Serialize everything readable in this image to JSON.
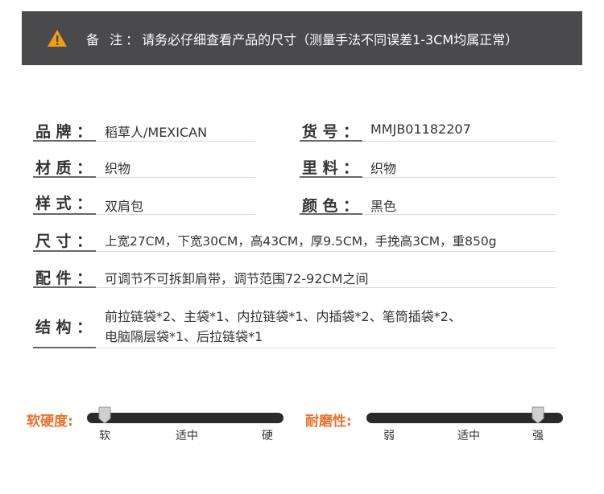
{
  "notice": {
    "label": "备 注：",
    "text": "请务必仔细查看产品的尺寸（测量手法不同误差1-3CM均属正常）",
    "icon": "warning-icon",
    "accent": "#f39c12"
  },
  "specs": {
    "brand": {
      "label": "品牌：",
      "value": "稻草人/MEXICAN"
    },
    "item_no": {
      "label": "货号：",
      "value": "MMJB01182207"
    },
    "material": {
      "label": "材质：",
      "value": "织物"
    },
    "lining": {
      "label": "里料：",
      "value": "织物"
    },
    "style": {
      "label": "样式：",
      "value": "双肩包"
    },
    "color": {
      "label": "颜色：",
      "value": "黑色"
    },
    "size": {
      "label": "尺寸：",
      "value": "上宽27CM，下宽30CM，高43CM，厚9.5CM，手挽高3CM，重850g"
    },
    "accessories": {
      "label": "配件：",
      "value": "可调节不可拆卸肩带，调节范围72-92CM之间"
    },
    "structure": {
      "label": "结构：",
      "line1": "前拉链袋*2、主袋*1、内拉链袋*1、内插袋*2、笔筒插袋*2、",
      "line2": "电脑隔层袋*1、后拉链袋*1"
    }
  },
  "sliders": {
    "softness": {
      "label": "软硬度:",
      "ticks": [
        "软",
        "适中",
        "硬"
      ],
      "level": 0.0
    },
    "durability": {
      "label": "耐磨性:",
      "ticks": [
        "弱",
        "适中",
        "强"
      ],
      "level": 1.0
    }
  },
  "colors": {
    "accent": "#ee6f2d",
    "notice_bg": "#4a4a4c",
    "track": "#2a2a2a"
  }
}
